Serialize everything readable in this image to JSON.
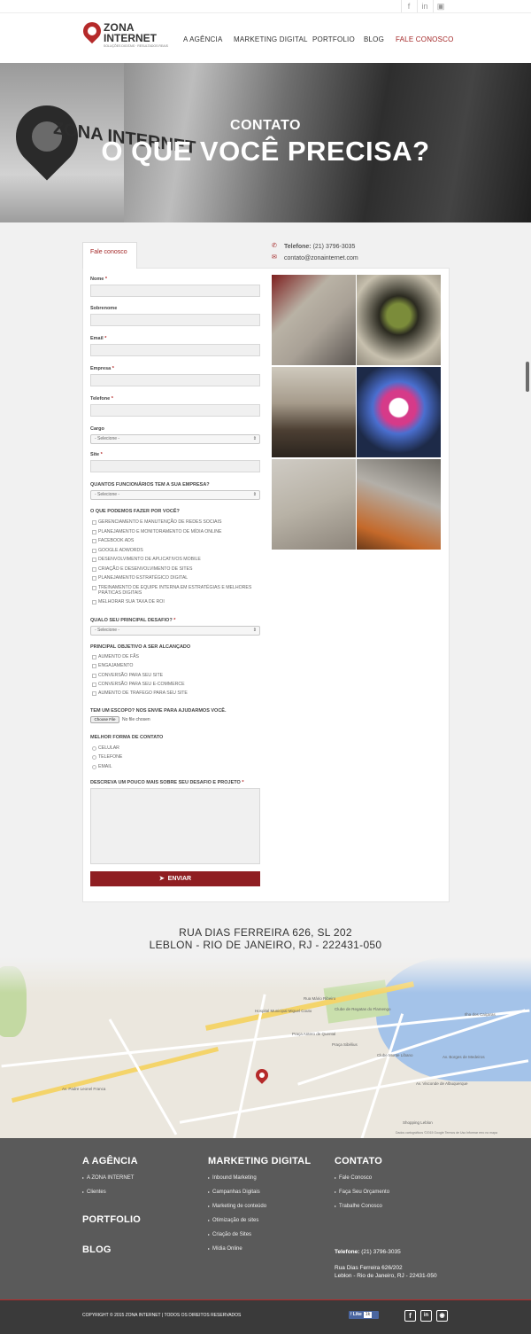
{
  "topbar": {
    "social": [
      "f",
      "in",
      "ig"
    ]
  },
  "header": {
    "logo": {
      "line1": "ZONA",
      "line2": "INTERNET",
      "tagline": "SOLUÇÕES DIGITAIS · RESULTADOS REAIS"
    },
    "nav": [
      {
        "label": "A AGÊNCIA"
      },
      {
        "label": "MARKETING DIGITAL"
      },
      {
        "label": "PORTFOLIO"
      },
      {
        "label": "BLOG"
      },
      {
        "label": "FALE CONOSCO",
        "active": true
      }
    ]
  },
  "hero": {
    "subtitle": "CONTATO",
    "title": "O QUE VOCÊ PRECISA?",
    "wall_sign": "ZONA INTERNET"
  },
  "contact": {
    "tab_label": "Fale conosco",
    "phone_label": "Telefone:",
    "phone": "(21) 3796-3035",
    "email": "contato@zonainternet.com"
  },
  "form": {
    "fields": {
      "nome": "Nome",
      "sobrenome": "Sobrenome",
      "email": "Email",
      "empresa": "Empresa",
      "telefone": "Telefone",
      "cargo": "Cargo",
      "site": "Site"
    },
    "cargo_select": "- Selecione -",
    "funcionarios_label": "QUANTOS FUNCIONÁRIOS TEM A SUA EMPRESA?",
    "funcionarios_select": "- Selecione -",
    "services_label": "O QUE PODEMOS FAZER POR VOCÊ?",
    "services": [
      "GERENCIAMENTO E MANUTENÇÃO DE REDES SOCIAIS",
      "PLANEJAMENTO E MONITORAMENTO DE MÍDIA ONLINE",
      "FACEBOOK ADS",
      "GOOGLE ADWORDS",
      "DESENVOLVIMENTO DE APLICATIVOS MOBILE",
      "CRIAÇÃO E DESENVOLVIMENTO DE SITES",
      "PLANEJAMENTO ESTRATÉGICO DIGITAL",
      "TREINAMENTO DE EQUIPE INTERNA EM ESTRATÉGIAS E MELHORES PRÁTICAS DIGITAIS",
      "MELHORAR SUA TAXA DE ROI"
    ],
    "challenge_label": "QUALO SEU PRINCIPAL DESAFIO?",
    "challenge_select": "- Selecione -",
    "objective_label": "PRINCIPAL OBJETIVO A SER ALCANÇADO",
    "objectives": [
      "AUMENTO DE FÃS",
      "ENGAJAMENTO",
      "CONVERSÃO PARA SEU SITE",
      "CONVERSÃO PARA SEU E-COMMERCE",
      "AUMENTO DE TRAFEGO PARA SEU SITE"
    ],
    "scope_label": "TEM UM ESCOPO? NOS ENVIE PARA AJUDARMOS VOCÊ.",
    "file_button": "Choose File",
    "file_status": "No file chosen",
    "contact_pref_label": "MELHOR FORMA DE CONTATO",
    "contact_prefs": [
      "CELULAR",
      "TELEFONE",
      "EMAIL"
    ],
    "describe_label": "DESCREVA UM POUCO MAIS SOBRE SEU DESAFIO E PROJETO",
    "submit": "ENVIAR",
    "required_mark": "*"
  },
  "address": {
    "line1": "RUA DIAS FERREIRA 626, SL 202",
    "line2": "LEBLON - RIO DE JANEIRO, RJ - 222431-050"
  },
  "map": {
    "labels": [
      "Rua Mário Ribeiro",
      "Hospital Municipal Miguel Couto",
      "Clube de Regatas do Flamengo",
      "Clube Monte Líbano",
      "Praça Antero de Quental",
      "Av. Padre Leonel Franca",
      "Shopping Leblon",
      "Ilha dos Caiçaras",
      "Av. Borges de Medeiros",
      "Praça Sibélius",
      "Av. Visconde de Albuquerque"
    ],
    "copyright": "Dados cartográficos ©2015 Google   Termos de Uso   Informar erro no mapa"
  },
  "footer": {
    "col1": {
      "title": "A AGÊNCIA",
      "links": [
        "A ZONA INTERNET",
        "Clientes"
      ],
      "title2": "PORTFOLIO",
      "title3": "BLOG"
    },
    "col2": {
      "title": "MARKETING DIGITAL",
      "links": [
        "Inbound Marketing",
        "Campanhas Digitais",
        "Marketing de conteúdo",
        "Otimização de sites",
        "Criação de Sites",
        "Mídia Online"
      ]
    },
    "col3": {
      "title": "CONTATO",
      "links": [
        "Fale Conosco",
        "Faça Seu Orçamento",
        "Trabalhe Conosco"
      ],
      "phone_label": "Telefone:",
      "phone": "(21) 3796-3035",
      "addr1": "Rua Dias Ferreira 626/202",
      "addr2": "Leblon - Rio de Janeiro, RJ - 22431-050"
    },
    "copyright": "COPYRIGHT © 2015 ZONA INTERNET | TODOS OS DIREITOS RESERVADOS",
    "fb_like": "Like",
    "fb_count": "1k",
    "social": [
      "f",
      "in",
      "ig"
    ]
  },
  "colors": {
    "brand_red": "#a32626",
    "button_red": "#8f1e22",
    "footer_bg": "#5a5a5a",
    "bottombar_bg": "#3a3a3a"
  }
}
